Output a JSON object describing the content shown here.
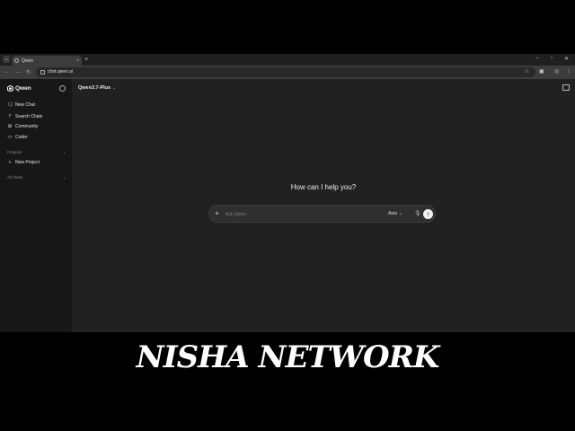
{
  "browser": {
    "tab_title": "Qwen",
    "tab_close": "×",
    "new_tab": "+",
    "url": "chat.qwen.ai",
    "win_min": "–",
    "win_max": "▫",
    "win_close": "✕"
  },
  "sidebar": {
    "brand": "Qwen",
    "items": [
      {
        "label": "New Chat",
        "icon": "chat-icon"
      },
      {
        "label": "Search Chats",
        "icon": "search-icon"
      },
      {
        "label": "Community",
        "icon": "grid-icon"
      },
      {
        "label": "Coder",
        "icon": "code-icon"
      }
    ],
    "projects_label": "Projects",
    "new_project": "New Project",
    "all_chats_label": "All chats"
  },
  "main": {
    "model": "Qwen3.7-Plus",
    "greeting": "How can I help you?",
    "input_placeholder": "Ask Qwen",
    "mode": "Auto"
  },
  "overlay": {
    "caption": "NISHA NETWORK"
  }
}
